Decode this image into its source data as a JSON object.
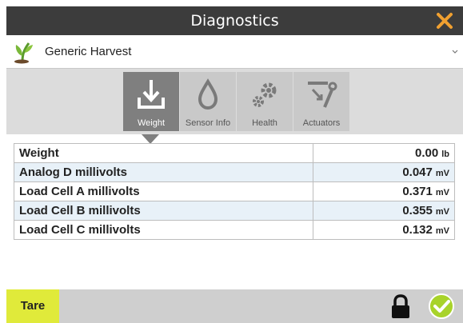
{
  "window": {
    "title": "Diagnostics",
    "close_icon": "close-icon",
    "accent": "#f0a030"
  },
  "profile": {
    "name": "Generic Harvest",
    "icon": "crop-plant-icon"
  },
  "tabs": [
    {
      "label": "Weight",
      "icon": "download-tray-icon",
      "active": true
    },
    {
      "label": "Sensor Info",
      "icon": "droplet-icon",
      "active": false
    },
    {
      "label": "Health",
      "icon": "gears-icon",
      "active": false
    },
    {
      "label": "Actuators",
      "icon": "actuator-arm-icon",
      "active": false
    }
  ],
  "rows": [
    {
      "label": "Weight",
      "value": "0.00",
      "unit": "lb"
    },
    {
      "label": "Analog D millivolts",
      "value": "0.047",
      "unit": "mV"
    },
    {
      "label": "Load Cell A millivolts",
      "value": "0.371",
      "unit": "mV"
    },
    {
      "label": "Load Cell B millivolts",
      "value": "0.355",
      "unit": "mV"
    },
    {
      "label": "Load Cell C millivolts",
      "value": "0.132",
      "unit": "mV"
    }
  ],
  "footer": {
    "tare_label": "Tare",
    "tare_color": "#e0ea3a",
    "ok_color": "#a8d32a"
  }
}
